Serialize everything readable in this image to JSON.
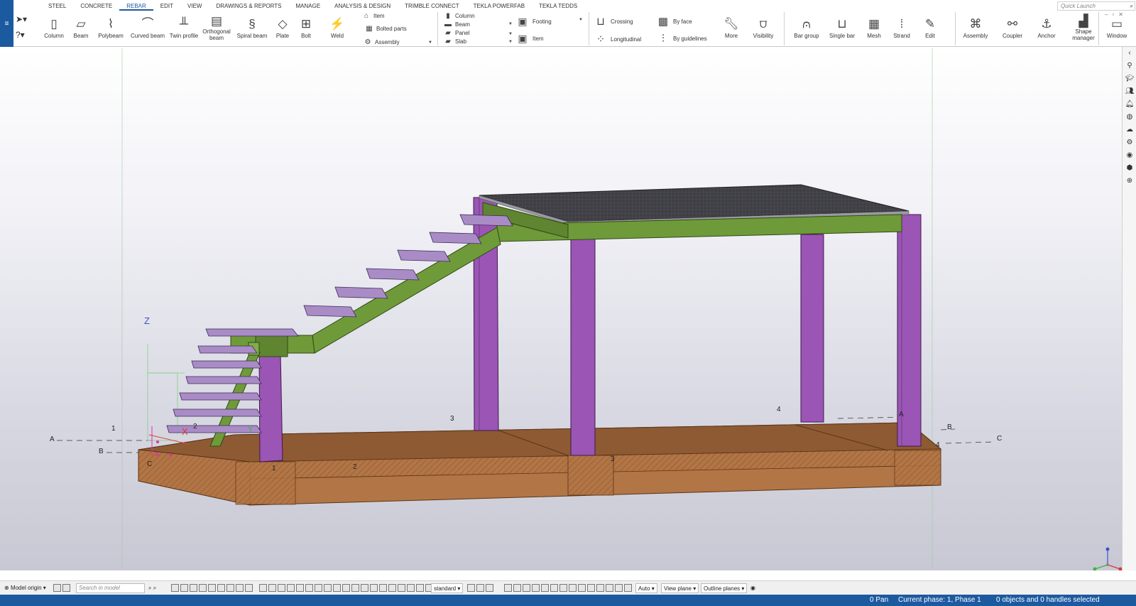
{
  "app_menu_glyph": "≡",
  "tabs": [
    "STEEL",
    "CONCRETE",
    "REBAR",
    "EDIT",
    "VIEW",
    "DRAWINGS & REPORTS",
    "MANAGE",
    "ANALYSIS & DESIGN",
    "TRIMBLE CONNECT",
    "TEKLA POWERFAB",
    "TEKLA TEDDS"
  ],
  "active_tab": "REBAR",
  "quick_launch": {
    "placeholder": "Quick Launch"
  },
  "steel_tools": {
    "column": "Column",
    "beam": "Beam",
    "polybeam": "Polybeam",
    "curved_beam": "Curved beam",
    "twin_profile": "Twin profile",
    "orthogonal_beam_1": "Orthogonal",
    "orthogonal_beam_2": "beam",
    "spiral_beam": "Spiral beam",
    "plate": "Plate",
    "bolt": "Bolt",
    "weld": "Weld",
    "item": "Item",
    "bolted_parts": "Bolted parts",
    "assembly": "Assembly"
  },
  "concrete_tools": {
    "column": "Column",
    "beam": "Beam",
    "panel": "Panel",
    "slab": "Slab",
    "footing": "Footing",
    "item": "Item"
  },
  "rebar_tools": {
    "crossing": "Crossing",
    "longitudinal": "Longitudinal",
    "by_face": "By face",
    "by_guidelines": "By guidelines",
    "more": "More",
    "visibility": "Visibility",
    "bar_group": "Bar group",
    "single_bar": "Single bar",
    "mesh": "Mesh",
    "strand": "Strand",
    "edit": "Edit",
    "assembly": "Assembly",
    "coupler": "Coupler",
    "anchor": "Anchor",
    "shape_manager_1": "Shape",
    "shape_manager_2": "manager",
    "window": "Window"
  },
  "grid_labels": {
    "a_left": "A",
    "b_left": "B",
    "c_left": "C",
    "one": "1",
    "two": "2",
    "one_b": "1",
    "two_b": "2",
    "three": "3",
    "three_b": "3",
    "four": "4",
    "four_b": "4",
    "a_right": "A",
    "b_right": "B",
    "c_right": "C"
  },
  "axes": {
    "z": "Z",
    "x": "X",
    "y": "Y"
  },
  "bottom_toolbar": {
    "model_origin": "Model origin",
    "search_placeholder": "Search in model",
    "standard": "standard",
    "auto": "Auto",
    "view_plane": "View plane",
    "outline_planes": "Outline planes"
  },
  "status": {
    "pan": "0 Pan",
    "phase": "Current phase: 1, Phase 1",
    "selection": "0 objects and 0 handles selected"
  },
  "colors": {
    "accent": "#1c5aa0",
    "column": "#9b55b5",
    "beam": "#6f9a3a",
    "step": "#a98cc6",
    "foundation": "#b27545",
    "deck": "#3e3e44"
  }
}
